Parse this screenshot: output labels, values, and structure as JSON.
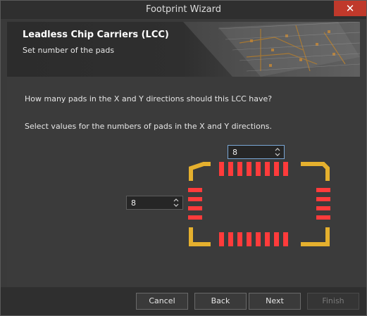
{
  "window": {
    "title": "Footprint Wizard",
    "close_glyph": "✕"
  },
  "banner": {
    "title": "Leadless Chip Carriers (LCC)",
    "subtitle": "Set number of the pads"
  },
  "content": {
    "question": "How many pads in the X and Y directions should this LCC have?",
    "instruction": "Select values for the numbers of pads in the X and Y directions."
  },
  "pads": {
    "x_count": "8",
    "y_count": "8",
    "pad_color": "#ff3b3b",
    "corner_color": "#e5b02e"
  },
  "footer": {
    "cancel_label": "Cancel",
    "back_label": "Back",
    "next_label": "Next",
    "finish_label": "Finish"
  },
  "colors": {
    "close_button": "#c0392b",
    "background": "#3b3b3b"
  }
}
